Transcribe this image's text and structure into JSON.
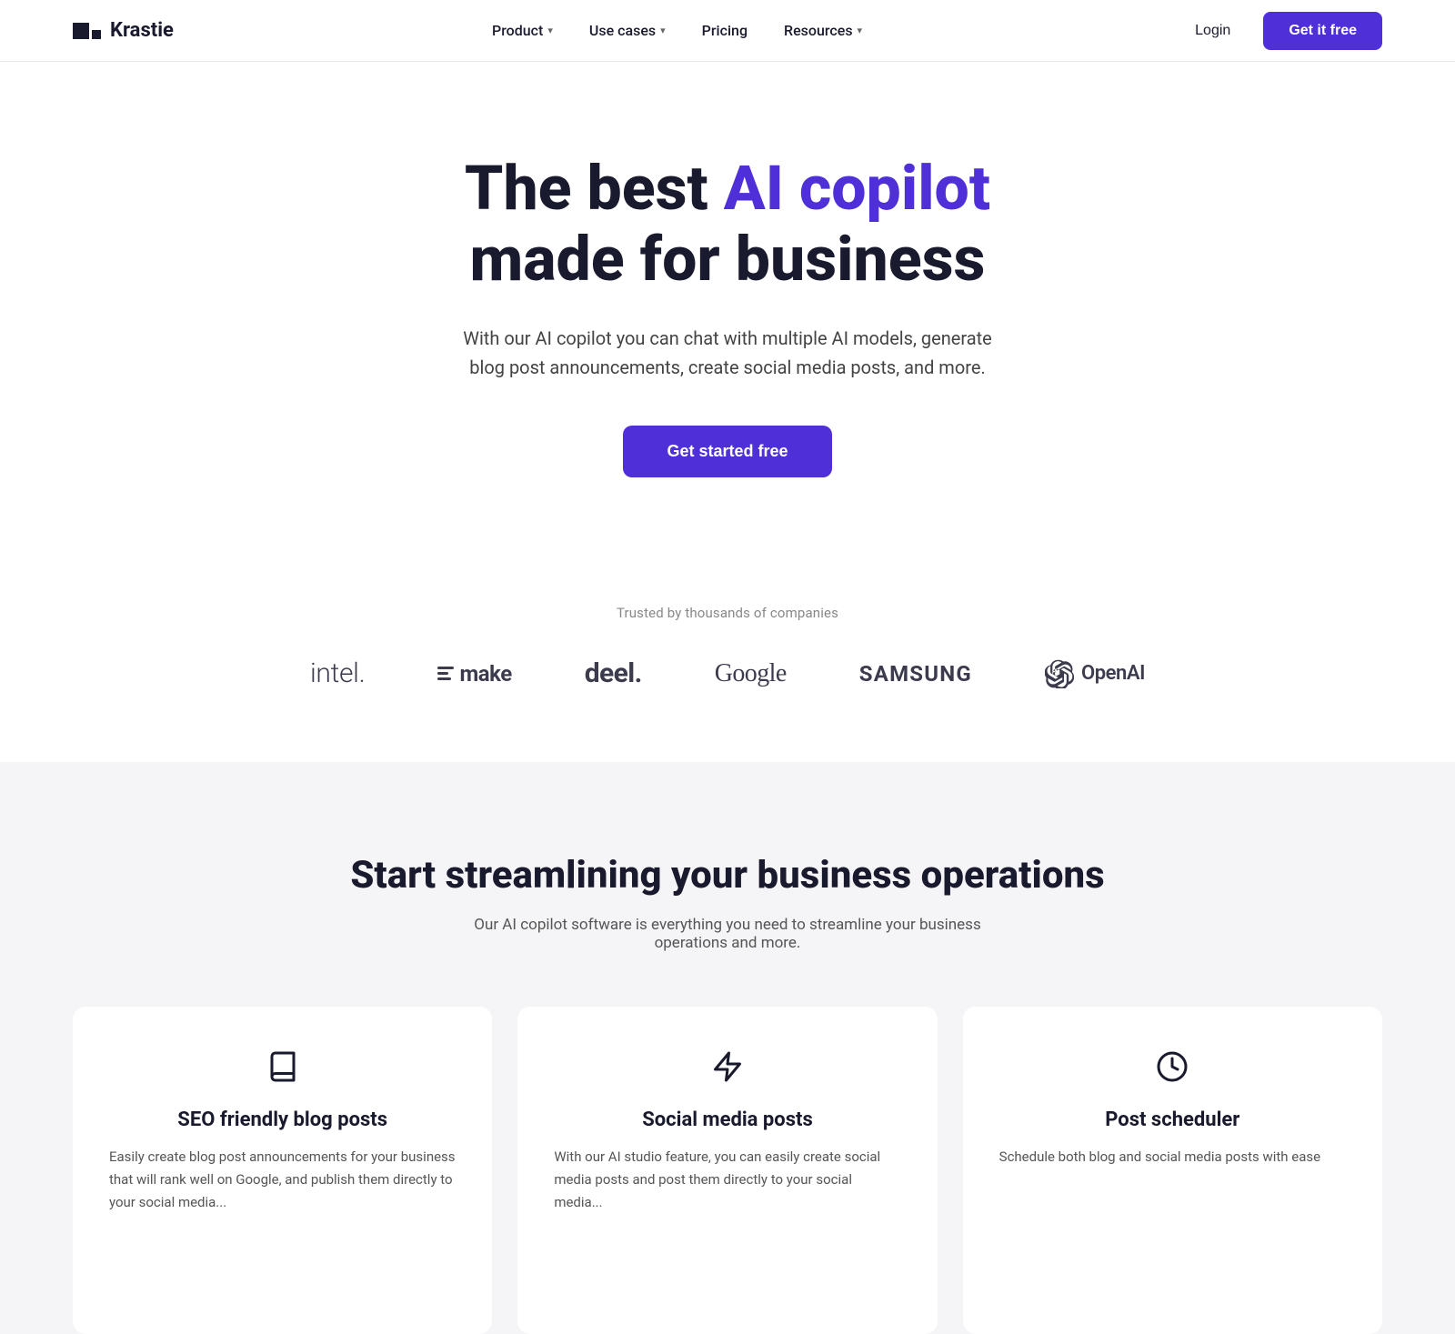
{
  "navbar": {
    "logo_text": "Krastie",
    "nav_items": [
      {
        "label": "Product",
        "has_dropdown": true
      },
      {
        "label": "Use cases",
        "has_dropdown": true
      },
      {
        "label": "Pricing",
        "has_dropdown": false
      },
      {
        "label": "Resources",
        "has_dropdown": true
      }
    ],
    "login_label": "Login",
    "cta_label": "Get it free"
  },
  "hero": {
    "title_plain": "The best ",
    "title_highlight": "AI copilot",
    "title_end": "made for business",
    "subtitle": "With our AI copilot you can chat with multiple AI models, generate blog post announcements, create social media posts, and more.",
    "cta_label": "Get started free"
  },
  "trusted": {
    "label": "Trusted by thousands of companies",
    "logos": [
      {
        "name": "Intel",
        "class": "intel"
      },
      {
        "name": "make",
        "class": "make-logo"
      },
      {
        "name": "deel.",
        "class": "deel"
      },
      {
        "name": "Google",
        "class": "google"
      },
      {
        "name": "SAMSUNG",
        "class": "samsung"
      },
      {
        "name": "OpenAI",
        "class": "openai"
      }
    ]
  },
  "features": {
    "title": "Start streamlining your business operations",
    "subtitle": "Our AI copilot software is everything you need to streamline your business operations and more.",
    "cards": [
      {
        "icon": "book",
        "title": "SEO friendly blog posts",
        "description": "Easily create blog post announcements for your business that will rank well on Google, and publish them directly to your social media..."
      },
      {
        "icon": "bolt",
        "title": "Social media posts",
        "description": "With our AI studio feature, you can easily create social media posts and post them directly to your social media..."
      },
      {
        "icon": "clock",
        "title": "Post scheduler",
        "description": "Schedule both blog and social media posts with ease"
      }
    ]
  }
}
